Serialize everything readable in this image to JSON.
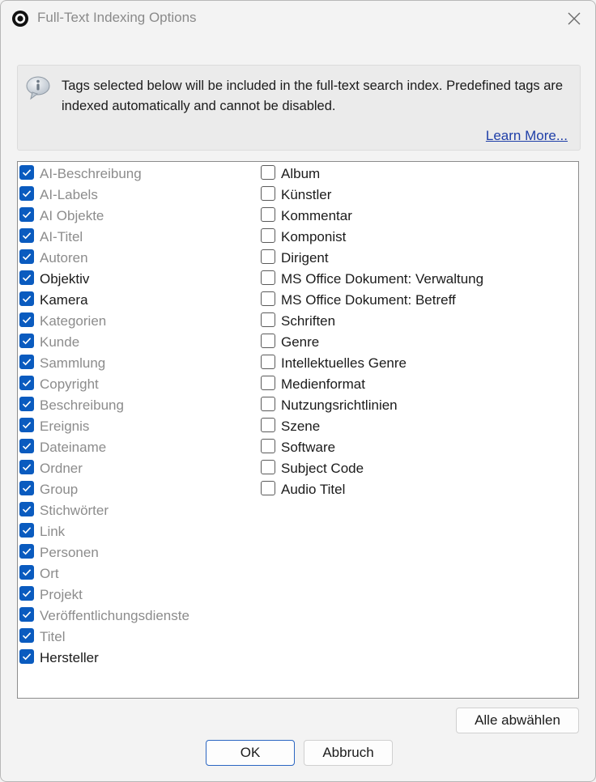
{
  "window": {
    "title": "Full-Text Indexing Options",
    "app_icon": "app-logo-icon",
    "close_icon": "close-icon"
  },
  "info": {
    "icon": "info-speech-bubble-icon",
    "text": "Tags selected below will be included in the full-text search index. Predefined tags are indexed automatically and cannot be disabled.",
    "learn_more": "Learn More..."
  },
  "tags_left": [
    {
      "label": "AI-Beschreibung",
      "checked": true,
      "disabled": true
    },
    {
      "label": "AI-Labels",
      "checked": true,
      "disabled": true
    },
    {
      "label": "AI Objekte",
      "checked": true,
      "disabled": true
    },
    {
      "label": "AI-Titel",
      "checked": true,
      "disabled": true
    },
    {
      "label": "Autoren",
      "checked": true,
      "disabled": true
    },
    {
      "label": "Objektiv",
      "checked": true,
      "disabled": false
    },
    {
      "label": "Kamera",
      "checked": true,
      "disabled": false
    },
    {
      "label": "Kategorien",
      "checked": true,
      "disabled": true
    },
    {
      "label": "Kunde",
      "checked": true,
      "disabled": true
    },
    {
      "label": "Sammlung",
      "checked": true,
      "disabled": true
    },
    {
      "label": "Copyright",
      "checked": true,
      "disabled": true
    },
    {
      "label": "Beschreibung",
      "checked": true,
      "disabled": true
    },
    {
      "label": "Ereignis",
      "checked": true,
      "disabled": true
    },
    {
      "label": "Dateiname",
      "checked": true,
      "disabled": true
    },
    {
      "label": "Ordner",
      "checked": true,
      "disabled": true
    },
    {
      "label": "Group",
      "checked": true,
      "disabled": true
    },
    {
      "label": "Stichwörter",
      "checked": true,
      "disabled": true
    },
    {
      "label": "Link",
      "checked": true,
      "disabled": true
    },
    {
      "label": "Personen",
      "checked": true,
      "disabled": true
    },
    {
      "label": "Ort",
      "checked": true,
      "disabled": true
    },
    {
      "label": "Projekt",
      "checked": true,
      "disabled": true
    },
    {
      "label": "Veröffentlichungsdienste",
      "checked": true,
      "disabled": true
    },
    {
      "label": "Titel",
      "checked": true,
      "disabled": true
    },
    {
      "label": "Hersteller",
      "checked": true,
      "disabled": false
    }
  ],
  "tags_right": [
    {
      "label": "Album",
      "checked": false,
      "disabled": false
    },
    {
      "label": "Künstler",
      "checked": false,
      "disabled": false
    },
    {
      "label": "Kommentar",
      "checked": false,
      "disabled": false
    },
    {
      "label": "Komponist",
      "checked": false,
      "disabled": false
    },
    {
      "label": "Dirigent",
      "checked": false,
      "disabled": false
    },
    {
      "label": "MS Office Dokument: Verwaltung",
      "checked": false,
      "disabled": false
    },
    {
      "label": "MS Office Dokument: Betreff",
      "checked": false,
      "disabled": false
    },
    {
      "label": "Schriften",
      "checked": false,
      "disabled": false
    },
    {
      "label": "Genre",
      "checked": false,
      "disabled": false
    },
    {
      "label": "Intellektuelles Genre",
      "checked": false,
      "disabled": false
    },
    {
      "label": "Medienformat",
      "checked": false,
      "disabled": false
    },
    {
      "label": "Nutzungsrichtlinien",
      "checked": false,
      "disabled": false
    },
    {
      "label": "Szene",
      "checked": false,
      "disabled": false
    },
    {
      "label": "Software",
      "checked": false,
      "disabled": false
    },
    {
      "label": "Subject Code",
      "checked": false,
      "disabled": false
    },
    {
      "label": "Audio Titel",
      "checked": false,
      "disabled": false
    }
  ],
  "buttons": {
    "deselect_all": "Alle abwählen",
    "ok": "OK",
    "cancel": "Abbruch"
  },
  "colors": {
    "accent": "#0a5bbf",
    "link": "#1f3fa8",
    "disabled_text": "#8c8c8c"
  }
}
